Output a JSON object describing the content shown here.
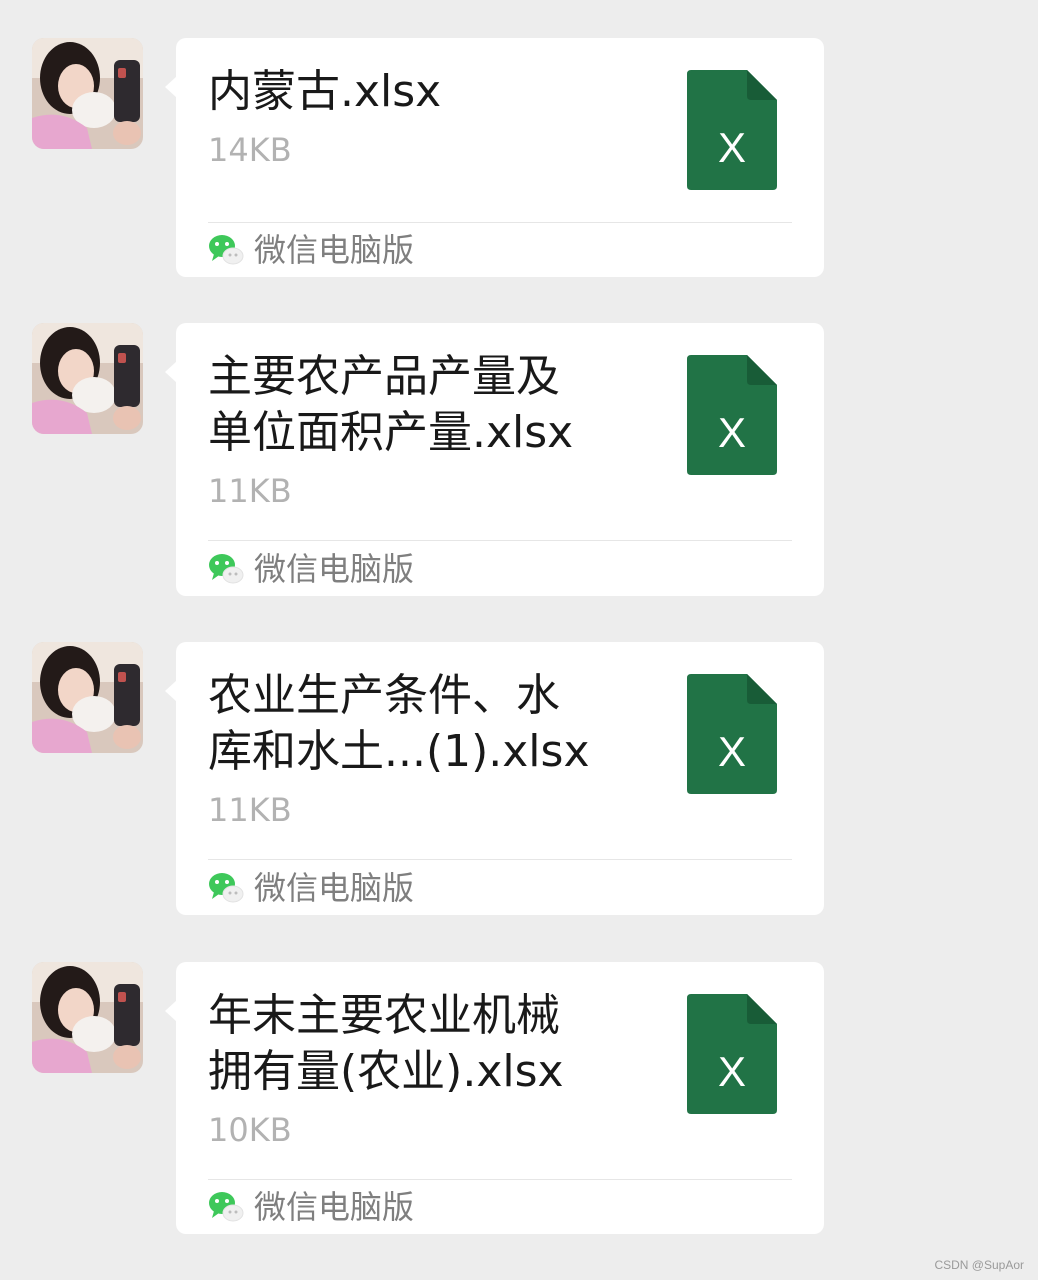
{
  "messages": [
    {
      "file_name": "内蒙古.xlsx",
      "file_size": "14KB",
      "file_icon_letter": "X",
      "source": "微信电脑版"
    },
    {
      "file_name": "主要农产品产量及\n单位面积产量.xlsx",
      "file_size": "11KB",
      "file_icon_letter": "X",
      "source": "微信电脑版"
    },
    {
      "file_name": "农业生产条件、水\n库和水土...(1).xlsx",
      "file_size": "11KB",
      "file_icon_letter": "X",
      "source": "微信电脑版"
    },
    {
      "file_name": "年末主要农业机械\n拥有量(农业).xlsx",
      "file_size": "10KB",
      "file_icon_letter": "X",
      "source": "微信电脑版"
    }
  ],
  "icons": {
    "avatar": "avatar-photo",
    "file": "excel-file-icon",
    "source": "wechat-icon"
  },
  "colors": {
    "background": "#ededed",
    "bubble": "#ffffff",
    "excel_green": "#217346",
    "wechat_green": "#3ec85a"
  },
  "watermark": "CSDN @SupAor"
}
